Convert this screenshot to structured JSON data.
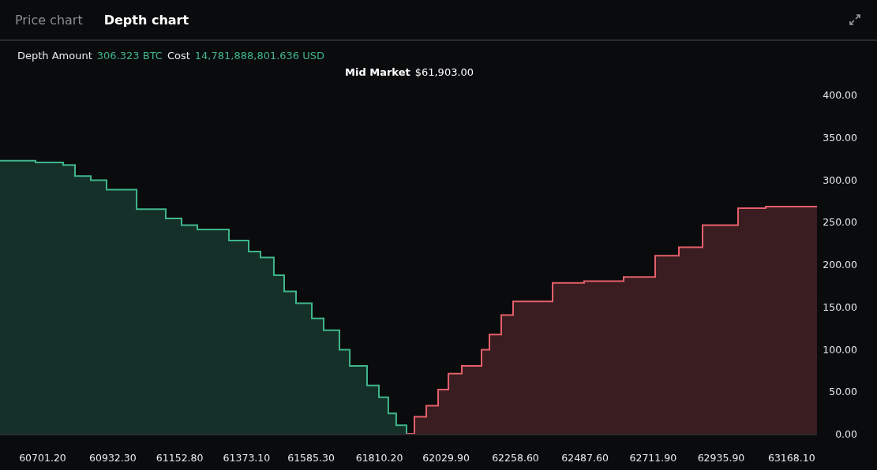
{
  "tabs": [
    {
      "label": "Price chart",
      "selected": false
    },
    {
      "label": "Depth chart",
      "selected": true
    }
  ],
  "summary": {
    "depth_label": "Depth Amount",
    "depth_value": "306.323 BTC",
    "cost_label": "Cost",
    "cost_value": "14,781,888,801.636 USD"
  },
  "mid_market": {
    "label": "Mid Market",
    "value": "$61,903.00"
  },
  "chart_data": {
    "type": "area",
    "x": [
      60553,
      60670,
      60761,
      60800,
      60852,
      60904,
      61003,
      61099,
      61151,
      61203,
      61307,
      61372,
      61411,
      61455,
      61489,
      61528,
      61580,
      61619,
      61671,
      61705,
      61762,
      61801,
      61832,
      61858,
      61892,
      61918,
      61957,
      61996,
      62030,
      62074,
      62139,
      62165,
      62204,
      62243,
      62373,
      62477,
      62607,
      62711,
      62789,
      62867,
      62984,
      63075,
      63244
    ],
    "series": [
      {
        "color": "#3fb68b",
        "values": [
          322,
          320,
          317,
          304,
          299,
          288,
          265,
          254,
          246,
          241,
          228,
          215,
          208,
          187,
          168,
          154,
          136,
          122,
          99,
          80,
          57,
          43,
          24,
          10,
          0,
          null,
          null,
          null,
          null,
          null,
          null,
          null,
          null,
          null,
          null,
          null,
          null,
          null,
          null,
          null,
          null,
          null,
          null
        ]
      },
      {
        "color": "#e5606a",
        "values": [
          null,
          null,
          null,
          null,
          null,
          null,
          null,
          null,
          null,
          null,
          null,
          null,
          null,
          null,
          null,
          null,
          null,
          null,
          null,
          null,
          null,
          null,
          null,
          null,
          0,
          20,
          33,
          52,
          71,
          80,
          99,
          117,
          140,
          156,
          178,
          180,
          185,
          210,
          220,
          246,
          266,
          268,
          268
        ]
      }
    ],
    "xlim": [
      60553,
      63244
    ],
    "ylim": [
      0,
      400
    ],
    "xticks": [
      {
        "value": 60701.2,
        "label": "60701.20"
      },
      {
        "value": 60932.3,
        "label": "60932.30"
      },
      {
        "value": 61152.8,
        "label": "61152.80"
      },
      {
        "value": 61373.1,
        "label": "61373.10"
      },
      {
        "value": 61585.3,
        "label": "61585.30"
      },
      {
        "value": 61810.2,
        "label": "61810.20"
      },
      {
        "value": 62029.9,
        "label": "62029.90"
      },
      {
        "value": 62258.6,
        "label": "62258.60"
      },
      {
        "value": 62487.6,
        "label": "62487.60"
      },
      {
        "value": 62711.9,
        "label": "62711.90"
      },
      {
        "value": 62935.9,
        "label": "62935.90"
      },
      {
        "value": 63168.1,
        "label": "63168.10"
      }
    ],
    "yticks": [
      {
        "value": 0,
        "label": "0.00"
      },
      {
        "value": 50,
        "label": "50.00"
      },
      {
        "value": 100,
        "label": "100.00"
      },
      {
        "value": 150,
        "label": "150.00"
      },
      {
        "value": 200,
        "label": "200.00"
      },
      {
        "value": 250,
        "label": "250.00"
      },
      {
        "value": 300,
        "label": "300.00"
      },
      {
        "value": 350,
        "label": "350.00"
      },
      {
        "value": 400,
        "label": "400.00"
      }
    ]
  }
}
